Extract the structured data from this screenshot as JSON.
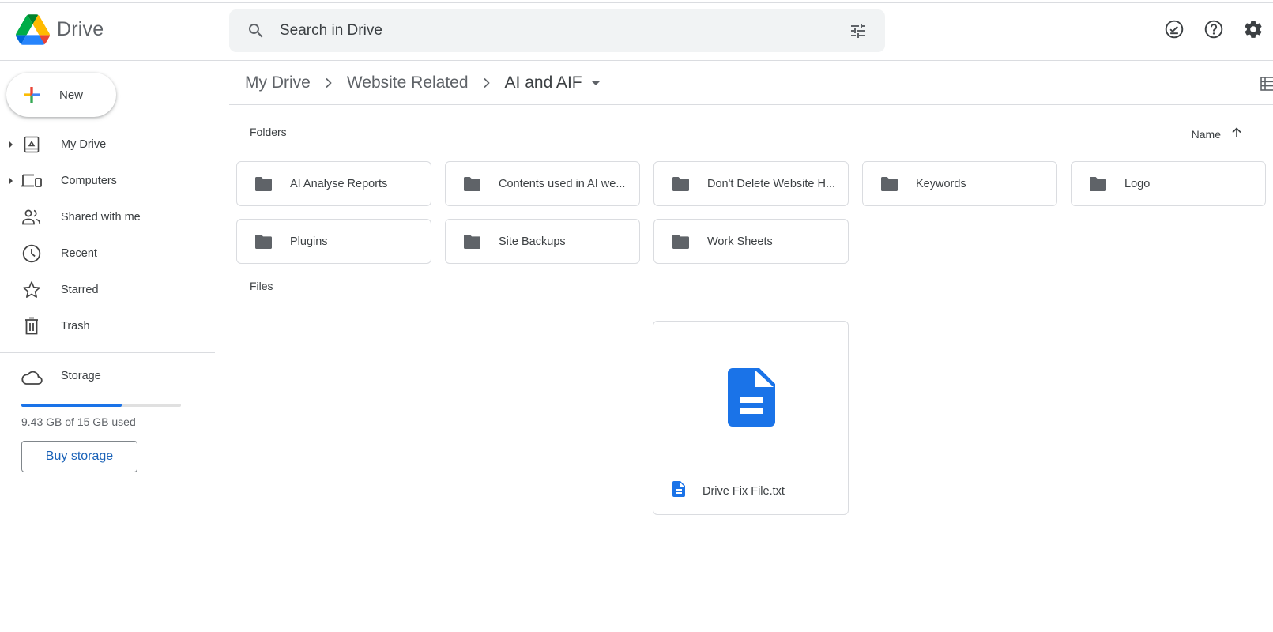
{
  "app": {
    "title": "Drive",
    "icons": {
      "logo": "google-drive-logo"
    }
  },
  "search": {
    "placeholder": "Search in Drive",
    "value": "",
    "icons": {
      "search": "search-icon",
      "filter": "tune-icon"
    }
  },
  "header_actions": [
    {
      "name": "ready-for-offline",
      "icon": "offline-check-icon"
    },
    {
      "name": "support",
      "icon": "help-icon"
    },
    {
      "name": "settings",
      "icon": "gear-icon"
    }
  ],
  "sidebar": {
    "new_label": "New",
    "items": [
      {
        "label": "My Drive",
        "icon": "my-drive-icon",
        "expandable": true
      },
      {
        "label": "Computers",
        "icon": "computers-icon",
        "expandable": true
      },
      {
        "label": "Shared with me",
        "icon": "people-icon",
        "expandable": false
      },
      {
        "label": "Recent",
        "icon": "clock-icon",
        "expandable": false
      },
      {
        "label": "Starred",
        "icon": "star-icon",
        "expandable": false
      },
      {
        "label": "Trash",
        "icon": "trash-icon",
        "expandable": false
      }
    ],
    "storage": {
      "label": "Storage",
      "icon": "cloud-icon",
      "used_text": "9.43 GB of 15 GB used",
      "used_gb": 9.43,
      "total_gb": 15,
      "used_fraction": 0.6287,
      "buy_label": "Buy storage"
    }
  },
  "breadcrumb": {
    "items": [
      "My Drive",
      "Website Related",
      "AI and AIF"
    ],
    "separator": "chevron-right-icon"
  },
  "main": {
    "folders_label": "Folders",
    "files_label": "Files",
    "sort": {
      "label": "Name",
      "direction": "ascending"
    },
    "view_toggle": "list-view-icon",
    "folders": [
      "AI Analyse Reports",
      "Contents used in AI we...",
      "Don't Delete Website H...",
      "Keywords",
      "Logo",
      "Plugins",
      "Site Backups",
      "Work Sheets"
    ],
    "files": [
      {
        "name": "Drive Fix File.txt",
        "type": "text-document"
      }
    ]
  },
  "colors": {
    "accent": "#1a73e8",
    "folder": "#5f6368",
    "text": "#3c4043",
    "search_bg": "#f1f3f4",
    "border": "#dadce0"
  }
}
